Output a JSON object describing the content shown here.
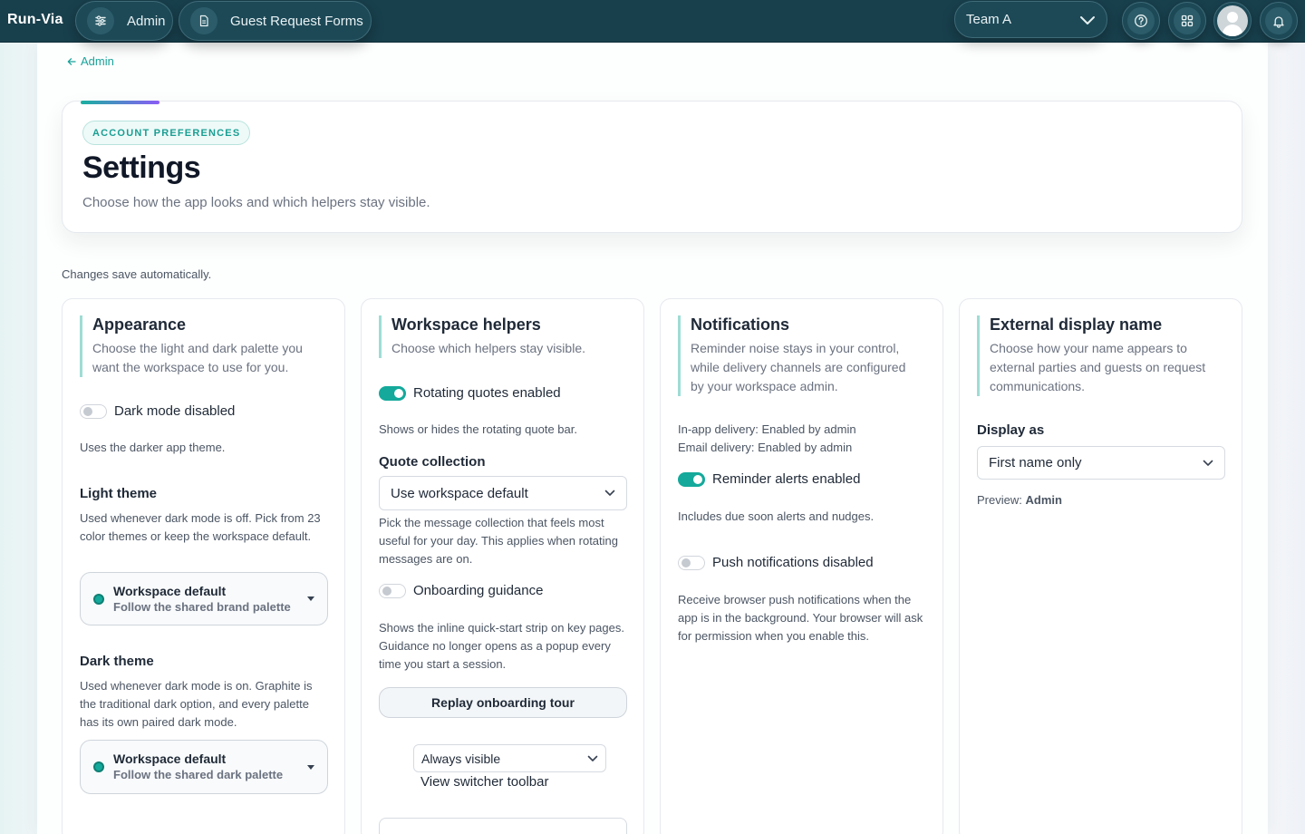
{
  "topbar": {
    "brand": "Run-Via",
    "admin_label": "Admin",
    "forms_label": "Guest Request Forms",
    "team_value": "Team A",
    "icons": [
      "sliders-icon",
      "document-icon",
      "help-circle-icon",
      "grid-icon",
      "avatar",
      "bell-icon"
    ]
  },
  "breadcrumb": {
    "back_label": "Admin"
  },
  "hero": {
    "badge": "ACCOUNT PREFERENCES",
    "title": "Settings",
    "subtitle": "Choose how the app looks and which helpers stay visible."
  },
  "autosave_note": "Changes save automatically.",
  "appearance": {
    "title": "Appearance",
    "desc": "Choose the light and dark palette you want the workspace to use for you.",
    "dark_mode_label": "Dark mode disabled",
    "dark_mode_on": false,
    "dark_mode_help": "Uses the darker app theme.",
    "light_theme_label": "Light theme",
    "light_theme_help": "Used whenever dark mode is off. Pick from 23 color themes or keep the workspace default.",
    "light_theme_value": "Workspace default",
    "light_theme_sub": "Follow the shared brand palette",
    "dark_theme_label": "Dark theme",
    "dark_theme_help": "Used whenever dark mode is on. Graphite is the traditional dark option, and every palette has its own paired dark mode.",
    "dark_theme_value": "Workspace default",
    "dark_theme_sub": "Follow the shared dark palette"
  },
  "helpers": {
    "title": "Workspace helpers",
    "desc": "Choose which helpers stay visible.",
    "quotes_label": "Rotating quotes enabled",
    "quotes_on": true,
    "quotes_help": "Shows or hides the rotating quote bar.",
    "collection_label": "Quote collection",
    "collection_value": "Use workspace default",
    "collection_help": "Pick the message collection that feels most useful for your day. This applies when rotating messages are on.",
    "onboarding_label": "Onboarding guidance",
    "onboarding_on": false,
    "onboarding_help": "Shows the inline quick-start strip on key pages. Guidance no longer opens as a popup every time you start a session.",
    "replay_button": "Replay onboarding tour",
    "toolbar_value": "Always visible",
    "toolbar_label": "View switcher toolbar"
  },
  "notifications": {
    "title": "Notifications",
    "desc": "Reminder noise stays in your control, while delivery channels are configured by your workspace admin.",
    "inapp_delivery": "In-app delivery: Enabled by admin",
    "email_delivery": "Email delivery: Enabled by admin",
    "reminder_label": "Reminder alerts enabled",
    "reminder_on": true,
    "reminder_help": "Includes due soon alerts and nudges.",
    "push_label": "Push notifications disabled",
    "push_on": false,
    "push_help": "Receive browser push notifications when the app is in the background. Your browser will ask for permission when you enable this."
  },
  "display_name": {
    "title": "External display name",
    "desc": "Choose how your name appears to external parties and guests on request communications.",
    "display_as_label": "Display as",
    "display_as_value": "First name only",
    "preview_prefix": "Preview:",
    "preview_value": "Admin"
  },
  "colors": {
    "topbar": "#183f4c",
    "accent": "#14a99b",
    "accent_gradient_end": "#8b5cf6"
  }
}
